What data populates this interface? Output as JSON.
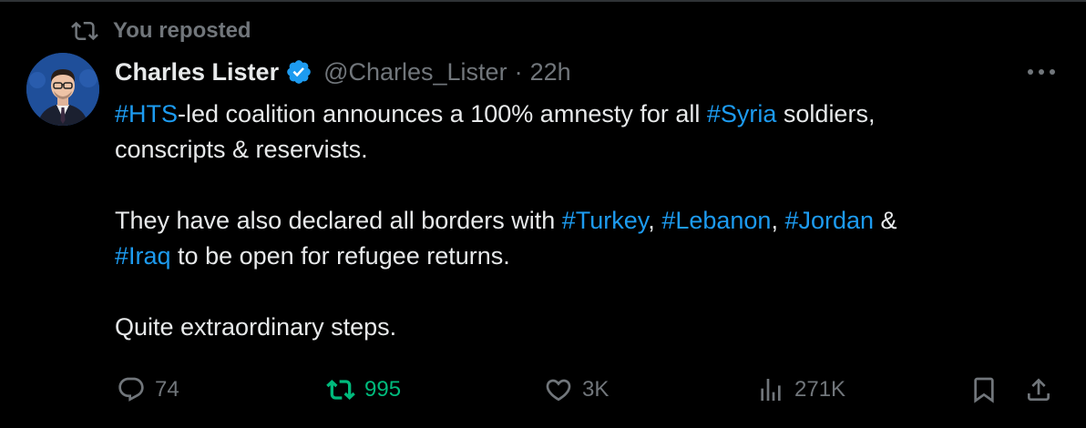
{
  "repost_banner": {
    "text": "You reposted",
    "icon": "repost-icon"
  },
  "author": {
    "display_name": "Charles Lister",
    "handle": "@Charles_Lister",
    "separator": "·",
    "time": "22h",
    "verified": true,
    "verified_color": "#1d9bf0"
  },
  "body": {
    "line1": {
      "tag1": "#HTS",
      "text1": "-led coalition announces a 100% amnesty for all ",
      "tag2": "#Syria",
      "text2": " soldiers,"
    },
    "line2": "conscripts & reservists.",
    "line3": {
      "text1": "They have also declared all borders with ",
      "tag1": "#Turkey",
      "sep1": ", ",
      "tag2": "#Lebanon",
      "sep2": ", ",
      "tag3": "#Jordan",
      "text2": " &"
    },
    "line4": {
      "tag1": "#Iraq",
      "text1": " to be open for refugee returns."
    },
    "line5": "Quite extraordinary steps."
  },
  "actions": {
    "reply": {
      "count": "74",
      "icon": "reply-icon"
    },
    "repost": {
      "count": "995",
      "icon": "repost-icon",
      "active": true,
      "color": "#00ba7c"
    },
    "like": {
      "count": "3K",
      "icon": "heart-icon"
    },
    "views": {
      "count": "271K",
      "icon": "views-icon"
    },
    "bookmark": {
      "icon": "bookmark-icon"
    },
    "share": {
      "icon": "share-icon"
    }
  },
  "colors": {
    "background": "#000000",
    "text": "#e7e9ea",
    "muted": "#71767b",
    "link": "#1d9bf0"
  }
}
